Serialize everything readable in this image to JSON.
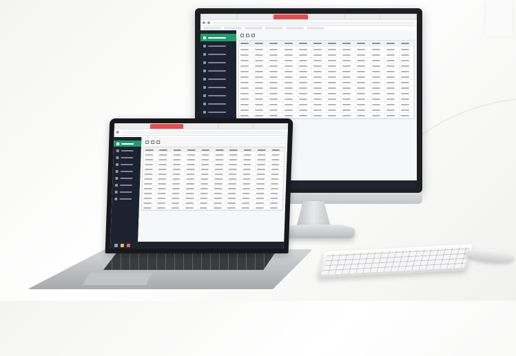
{
  "scene": {
    "devices": [
      "monitor",
      "laptop",
      "keyboard",
      "mouse"
    ]
  },
  "app": {
    "sidebar_count_monitor": 10,
    "sidebar_count_laptop": 9,
    "grid_rows_monitor": 14,
    "grid_rows_laptop": 13,
    "grid_cols": 12,
    "active_color": "#1f9d6a",
    "sidebar_color": "#1c2230"
  }
}
